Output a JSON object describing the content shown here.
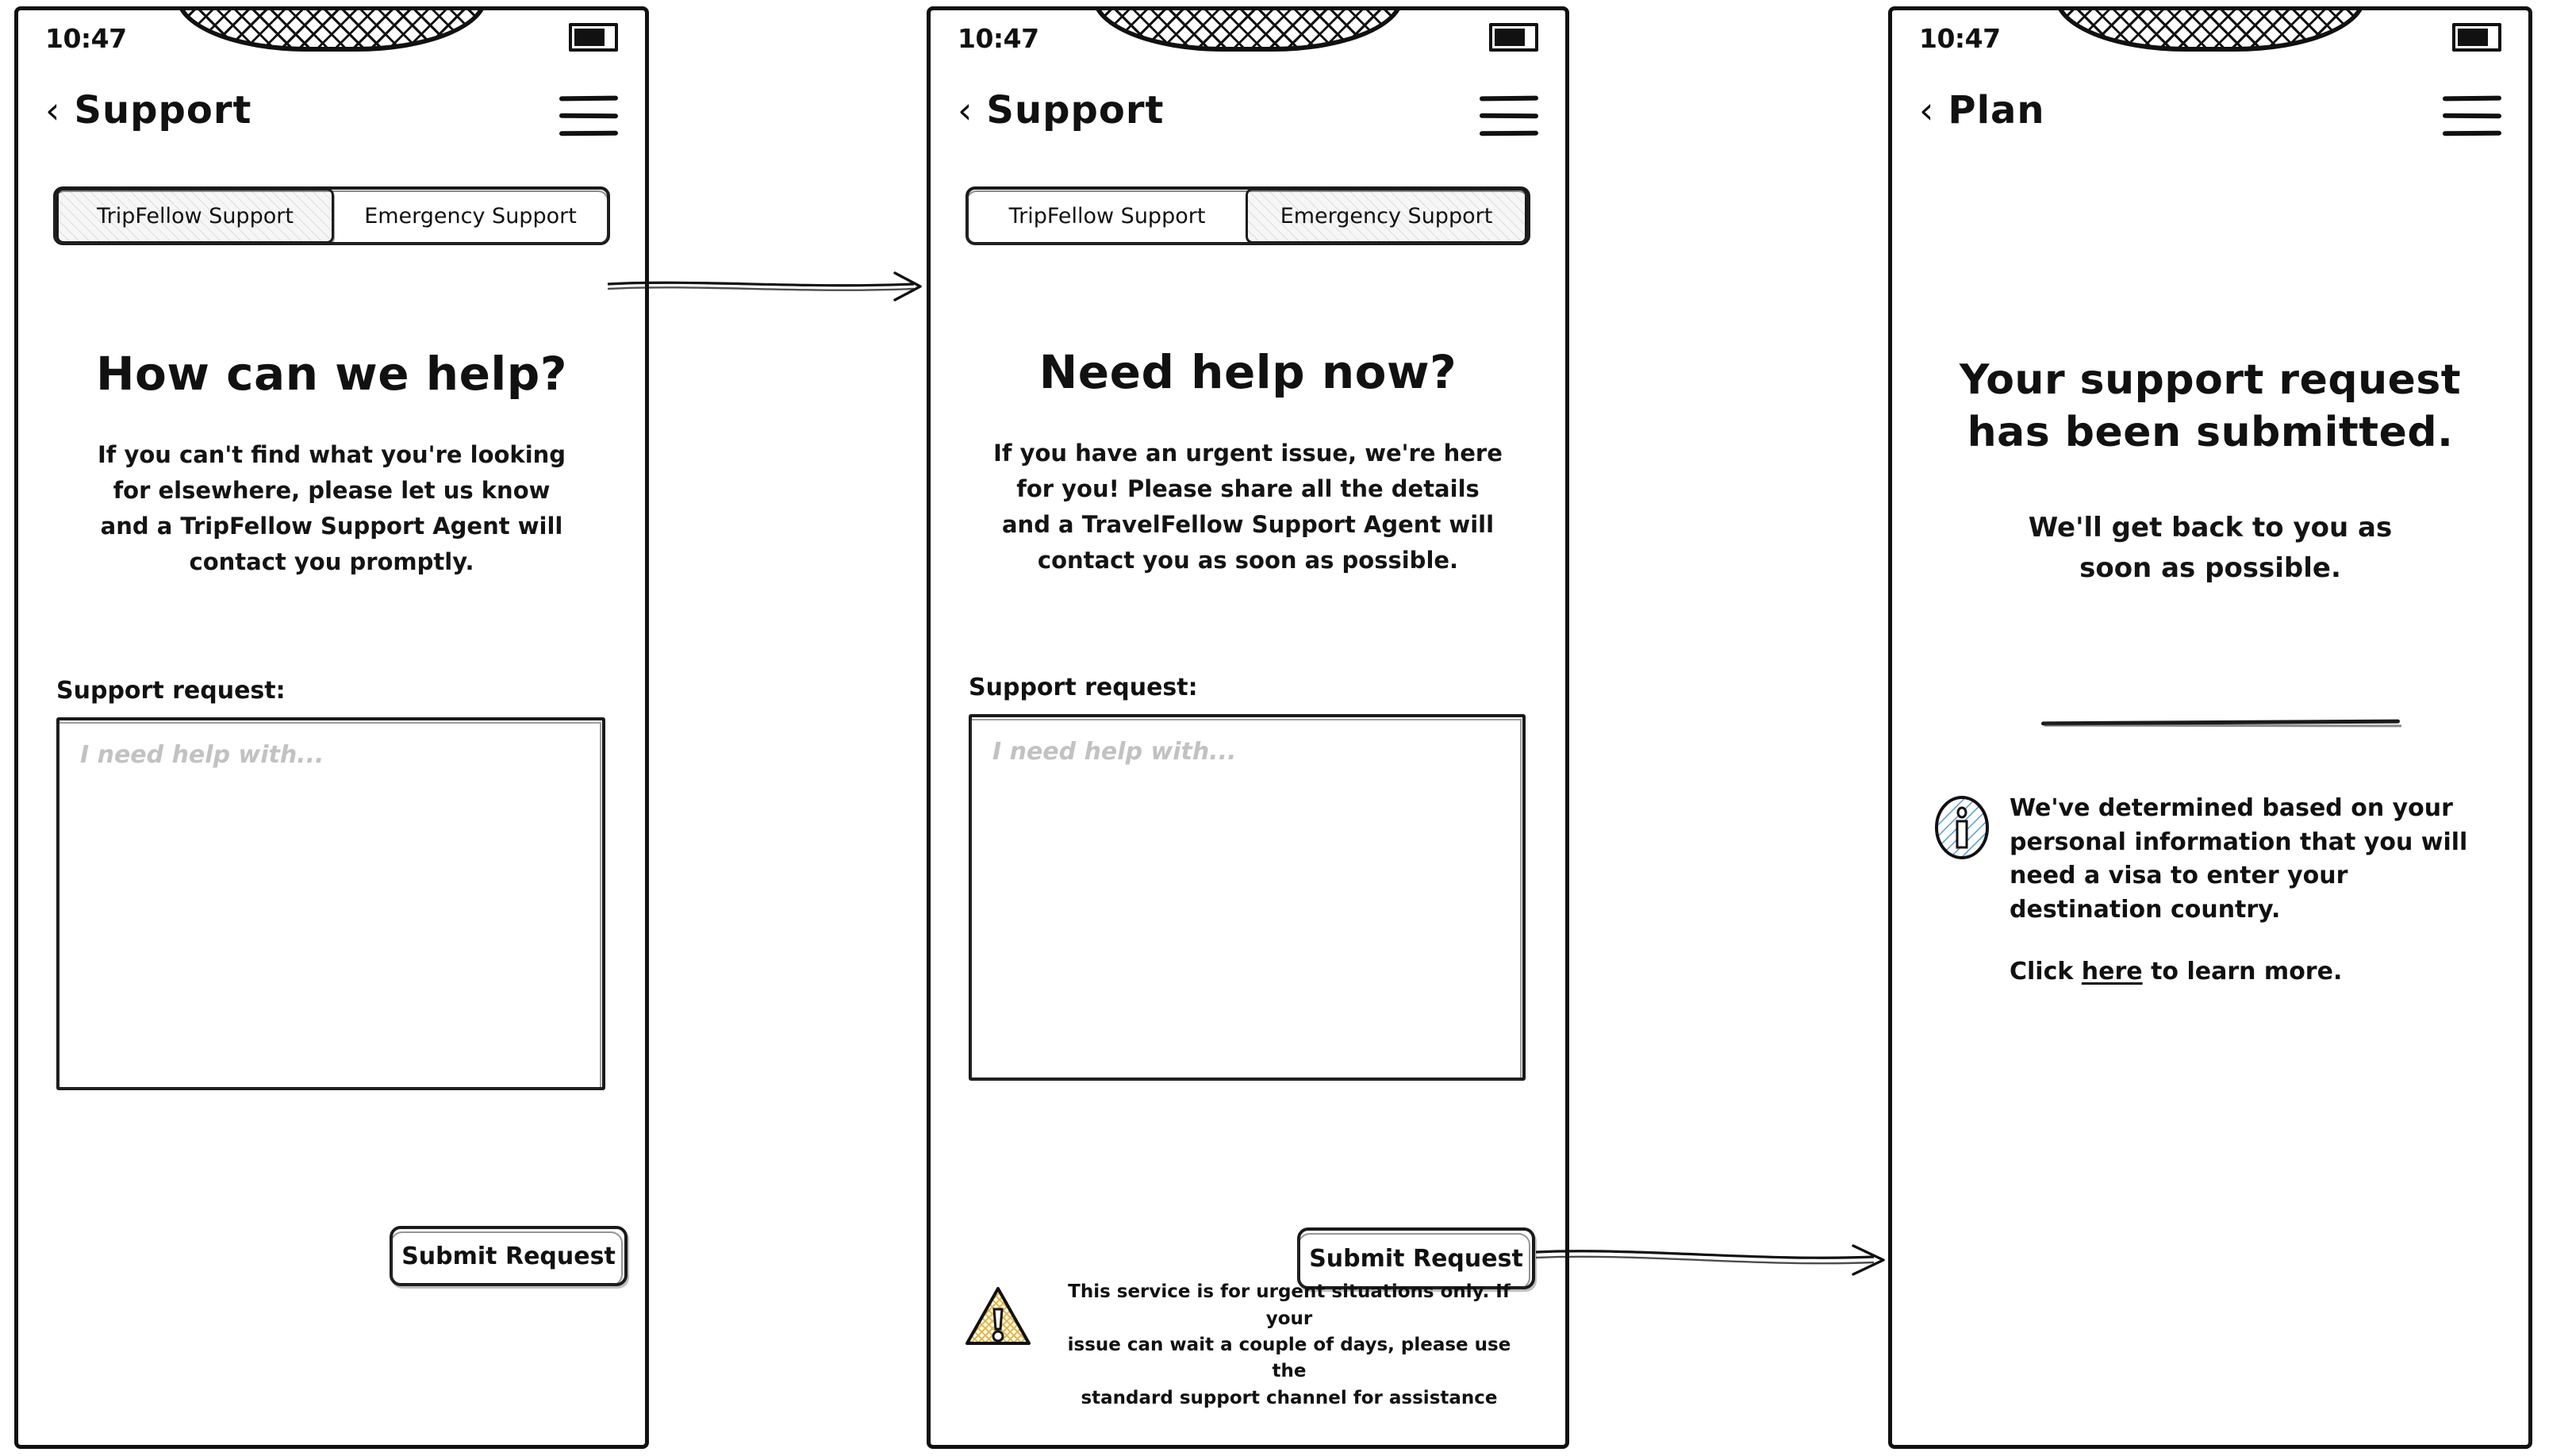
{
  "status_bar": {
    "time": "10:47",
    "battery_icon": "battery-icon",
    "notch_icon": "notch-speaker"
  },
  "screens": [
    {
      "id": "support-tripfellow",
      "nav": {
        "back_icon": "chevron-left-icon",
        "title": "Support",
        "menu_icon": "hamburger-menu-icon"
      },
      "tabs": [
        {
          "label": "TripFellow Support",
          "selected": true
        },
        {
          "label": "Emergency Support",
          "selected": false
        }
      ],
      "heading": "How can we help?",
      "body_lines": [
        "If you can't find what you're looking",
        "for elsewhere, please let us know",
        "and a TripFellow Support Agent will",
        "contact you promptly."
      ],
      "field": {
        "label": "Support request:",
        "placeholder": "I need help with...",
        "value": ""
      },
      "submit_label": "Submit Request"
    },
    {
      "id": "support-emergency",
      "nav": {
        "back_icon": "chevron-left-icon",
        "title": "Support",
        "menu_icon": "hamburger-menu-icon"
      },
      "tabs": [
        {
          "label": "TripFellow Support",
          "selected": false
        },
        {
          "label": "Emergency Support",
          "selected": true
        }
      ],
      "heading": "Need help now?",
      "body_lines": [
        "If you have an urgent issue, we're here",
        "for you! Please share all the details",
        "and a TravelFellow Support Agent will",
        "contact you as soon as possible."
      ],
      "field": {
        "label": "Support request:",
        "placeholder": "I need help with...",
        "value": ""
      },
      "submit_label": "Submit Request",
      "warning": {
        "icon": "warning-triangle-icon",
        "icon_color": "#e8b53b",
        "lines": [
          "This service is for urgent situations only. If your",
          "issue can wait a couple of days, please use the",
          "standard support channel for assistance"
        ]
      }
    },
    {
      "id": "plan-confirmation",
      "nav": {
        "back_icon": "chevron-left-icon",
        "title": "Plan",
        "menu_icon": "hamburger-menu-icon"
      },
      "heading_lines": [
        "Your support request",
        "has been submitted."
      ],
      "subtext_lines": [
        "We'll get back to you as",
        "soon as possible."
      ],
      "divider": "horizontal-rule",
      "info": {
        "icon": "info-circle-icon",
        "icon_color": "#5b9bd5",
        "lines": [
          "We've determined based on your",
          "personal information that you will",
          "need a visa to enter your",
          "destination country."
        ],
        "link_prefix": "Click ",
        "link_label": "here",
        "link_suffix": " to learn more."
      }
    }
  ],
  "flow_arrows": [
    {
      "name": "arrow-tab-to-emergency",
      "from": "emergency-support-tab",
      "to": "screen-2"
    },
    {
      "name": "arrow-submit-to-confirmation",
      "from": "submit-request-button",
      "to": "screen-3"
    }
  ],
  "colors": {
    "ink": "#111111",
    "placeholder": "#c2c2c2",
    "selected_tab_fill": "#f6f6f6",
    "warning": "#e8b53b",
    "info": "#5b9bd5"
  }
}
